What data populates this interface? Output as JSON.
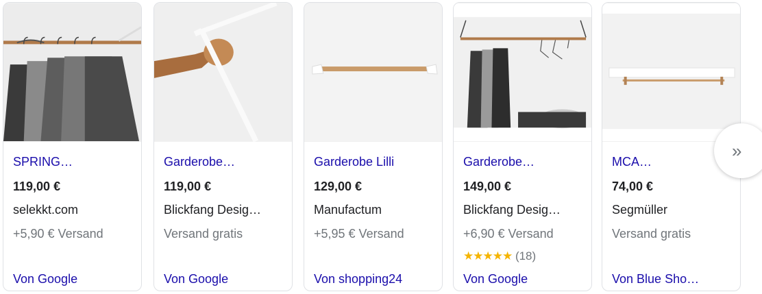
{
  "cards": [
    {
      "title": "SPRING…",
      "price": "119,00 €",
      "merchant": "selekkt.com",
      "shipping": "+5,90 € Versand",
      "source": "Von Google",
      "image_icon": "clothes-rail-with-shirts-image"
    },
    {
      "title": "Garderobe…",
      "price": "119,00 €",
      "merchant": "Blickfang Desig…",
      "shipping": "Versand gratis",
      "source": "Von Google",
      "image_icon": "wooden-rod-closeup-image"
    },
    {
      "title": "Garderobe Lilli",
      "price": "129,00 €",
      "merchant": "Manufactum",
      "shipping": "+5,95 € Versand",
      "source": "Von shopping24",
      "image_icon": "wooden-rail-image"
    },
    {
      "title": "Garderobe…",
      "price": "149,00 €",
      "merchant": "Blickfang Desig…",
      "shipping": "+6,90 € Versand",
      "rating_stars": "★★★★★",
      "rating_count": "(18)",
      "rating_value": 5,
      "source": "Von Google",
      "image_icon": "wall-rail-with-clothes-image"
    },
    {
      "title": "MCA…",
      "price": "74,00 €",
      "merchant": "Segmüller",
      "shipping": "Versand gratis",
      "source": "Von Blue Sho…",
      "image_icon": "wall-shelf-with-rail-image"
    }
  ],
  "next_button": {
    "label": "»"
  },
  "colors": {
    "link": "#1a0dab",
    "text": "#202124",
    "muted": "#70757a",
    "star": "#f5b400",
    "border": "#dfe1e5"
  }
}
